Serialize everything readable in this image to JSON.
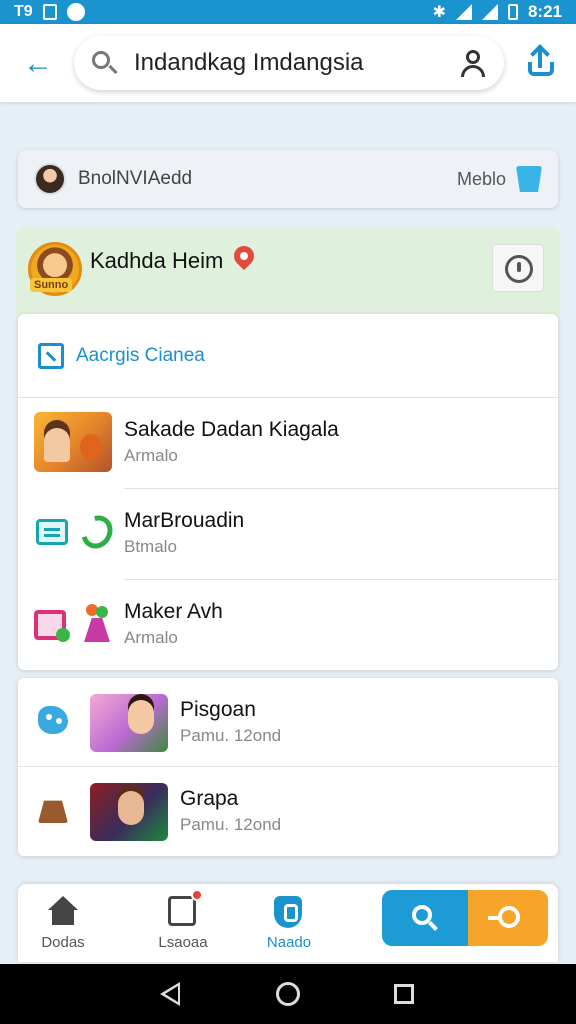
{
  "status_bar": {
    "left_text": "T9",
    "time": "8:21"
  },
  "app_bar": {
    "search_value": "Indandkag Imdangsia"
  },
  "account": {
    "name": "BnolNVIAedd",
    "type": "Meblo"
  },
  "profile": {
    "name": "Kadhda Heim",
    "avatar_label": "Sunno"
  },
  "section": {
    "title": "Aacrgis Cianea",
    "rows": [
      {
        "title": "Sakade Dadan Kiagala",
        "subtitle": "Armalo"
      },
      {
        "title": "MarBrouadin",
        "subtitle": "Btmalo"
      },
      {
        "title": "Maker Avh",
        "subtitle": "Armalo"
      }
    ]
  },
  "games": [
    {
      "title": "Pisgoan",
      "subtitle": "Pamu. 12ond"
    },
    {
      "title": "Grapa",
      "subtitle": "Pamu. 12ond"
    }
  ],
  "bottom_nav": {
    "items": [
      {
        "label": "Dodas",
        "icon": "home-icon"
      },
      {
        "label": "Lsaoaa",
        "icon": "store-icon"
      },
      {
        "label": "Naado",
        "icon": "shield-icon"
      }
    ]
  },
  "colors": {
    "accent": "#1a93cf",
    "orange": "#f7a42a",
    "profile_bg": "#dff0dd"
  }
}
